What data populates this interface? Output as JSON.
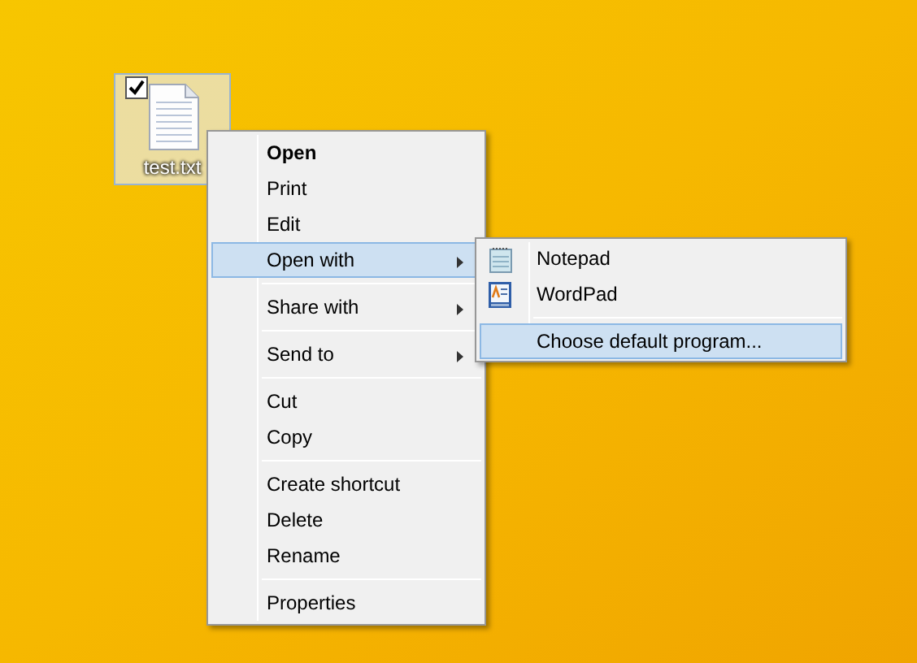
{
  "desktop_icon": {
    "label": "test.txt",
    "selected": true,
    "checked": true
  },
  "context_menu": {
    "groups": [
      [
        {
          "label": "Open",
          "default": true,
          "submenu": false,
          "selected": false
        },
        {
          "label": "Print",
          "default": false,
          "submenu": false,
          "selected": false
        },
        {
          "label": "Edit",
          "default": false,
          "submenu": false,
          "selected": false
        },
        {
          "label": "Open with",
          "default": false,
          "submenu": true,
          "selected": true
        }
      ],
      [
        {
          "label": "Share with",
          "default": false,
          "submenu": true,
          "selected": false
        }
      ],
      [
        {
          "label": "Send to",
          "default": false,
          "submenu": true,
          "selected": false
        }
      ],
      [
        {
          "label": "Cut",
          "default": false,
          "submenu": false,
          "selected": false
        },
        {
          "label": "Copy",
          "default": false,
          "submenu": false,
          "selected": false
        }
      ],
      [
        {
          "label": "Create shortcut",
          "default": false,
          "submenu": false,
          "selected": false
        },
        {
          "label": "Delete",
          "default": false,
          "submenu": false,
          "selected": false
        },
        {
          "label": "Rename",
          "default": false,
          "submenu": false,
          "selected": false
        }
      ],
      [
        {
          "label": "Properties",
          "default": false,
          "submenu": false,
          "selected": false
        }
      ]
    ]
  },
  "submenu": {
    "groups": [
      [
        {
          "label": "Notepad",
          "kind": "notepad",
          "selected": false
        },
        {
          "label": "WordPad",
          "kind": "wordpad",
          "selected": false
        }
      ],
      [
        {
          "label": "Choose default program...",
          "kind": "plain",
          "selected": true
        }
      ]
    ]
  }
}
